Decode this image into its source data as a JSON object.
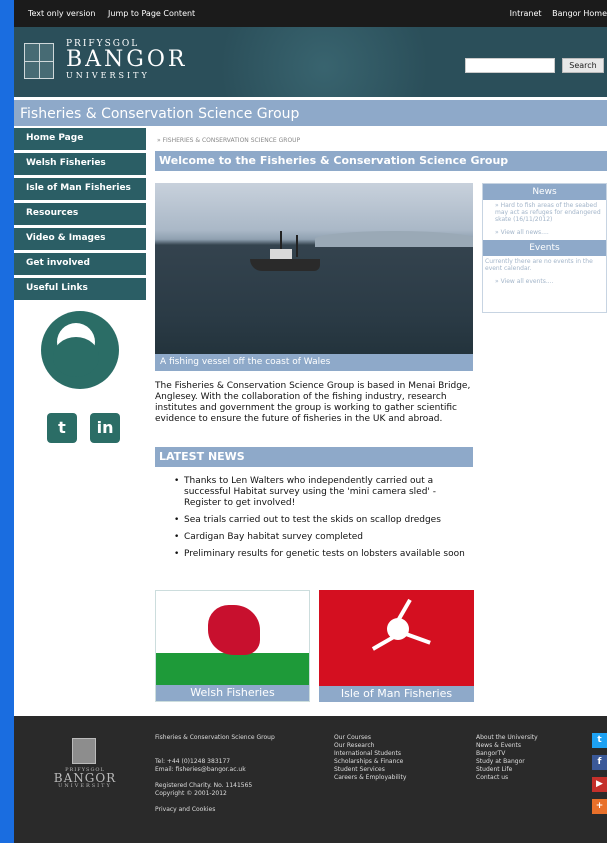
{
  "topbar": {
    "text_only": "Text only version",
    "jump": "Jump to Page Content",
    "intranet": "Intranet",
    "home": "Bangor Home"
  },
  "masthead": {
    "logo_line1": "PRIFYSGOL",
    "logo_line2": "BANGOR",
    "logo_line3": "UNIVERSITY",
    "search_label": "Search",
    "search_value": ""
  },
  "groupbar": "Fisheries & Conservation Science Group",
  "nav": [
    "Home Page",
    "Welsh Fisheries",
    "Isle of Man Fisheries",
    "Resources",
    "Video & Images",
    "Get involved",
    "Useful Links"
  ],
  "social": {
    "twitter": "twitter-icon",
    "linkedin": "linkedin-icon"
  },
  "breadcrumb": "» FISHERIES & CONSERVATION SCIENCE GROUP",
  "welcome": "Welcome to the Fisheries & Conservation Science Group",
  "main_image_caption": "A fishing vessel off the coast of Wales",
  "intro": "The Fisheries & Conservation Science Group is based in Menai Bridge, Anglesey. With the collaboration of the fishing industry, research institutes and government the group is working to gather scientific evidence to ensure the future of fisheries in the UK and abroad.",
  "latest_news": {
    "heading": "LATEST NEWS",
    "items": [
      "Thanks to Len Walters who independently carried out a successful Habitat survey using the 'mini camera sled' - Register to get involved!",
      "Sea trials carried out to test the skids on scallop dredges",
      "Cardigan Bay habitat survey completed",
      "Preliminary results for genetic tests on lobsters available soon"
    ]
  },
  "flags": {
    "wales": "Welsh Fisheries",
    "iom": "Isle of Man Fisheries"
  },
  "news_box": {
    "heading": "News",
    "item": "» Hard to fish areas of the seabed may act as refuges for endangered skate (16/11/2012)",
    "more": "» View all news....",
    "events_heading": "Events",
    "events_text": "Currently there are no events in the event calendar.",
    "events_more": "» View all events...."
  },
  "footer": {
    "logo_line1": "PRIFYSGOL",
    "logo_line2": "BANGOR",
    "logo_line3": "UNIVERSITY",
    "col1": {
      "name": "Fisheries & Conservation Science Group",
      "tel": "Tel: +44 (0)1248 383177",
      "email": "Email: fisheries@bangor.ac.uk",
      "charity": "Registered Charity. No. 1141565",
      "copyright": "Copyright © 2001-2012",
      "privacy": "Privacy and Cookies"
    },
    "col2": [
      "Our Courses",
      "Our Research",
      "International Students",
      "Scholarships & Finance",
      "Student Services",
      "Careers & Employability"
    ],
    "col3": [
      "About the University",
      "News & Events",
      "BangorTV",
      "Study at Bangor",
      "Student Life",
      "Contact us"
    ]
  },
  "colors": {
    "accent": "#8ea9c9",
    "nav": "#2b5e65",
    "footer": "#2a2a2a",
    "background": "#1a6de0"
  }
}
